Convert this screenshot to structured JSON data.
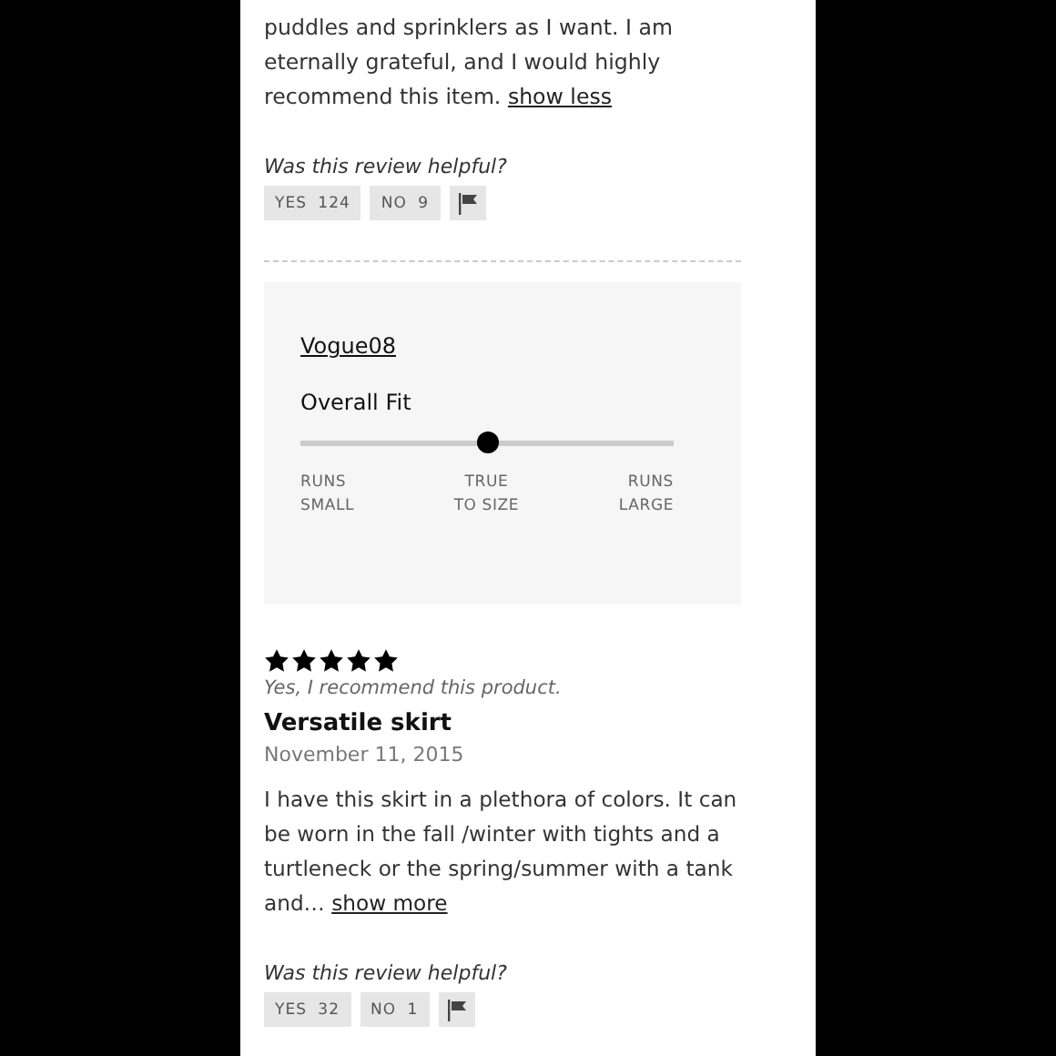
{
  "top_review": {
    "body_lines": [
      "puddles and sprinklers as I want. I am",
      "eternally grateful, and I would highly",
      "recommend this item."
    ],
    "toggle_link": "show less",
    "helpful": {
      "question": "Was this review helpful?",
      "yes_label": "YES",
      "yes_count": "124",
      "no_label": "NO",
      "no_count": "9"
    }
  },
  "reviewer_card": {
    "username": "Vogue08",
    "fit_title": "Overall Fit",
    "level": 0.5,
    "scale_labels": [
      [
        "RUNS",
        "SMALL"
      ],
      [
        "TRUE",
        "TO SIZE"
      ],
      [
        "RUNS",
        "LARGE"
      ]
    ]
  },
  "review": {
    "stars": 5,
    "recommend": "Yes, I recommend this product.",
    "title": "Versatile skirt",
    "date": "November 11, 2015",
    "body": "I have this skirt in a plethora of colors. It can be worn in the fall /winter with tights and a turtleneck or the spring/summer with a tank and…",
    "toggle_link": "show more",
    "helpful": {
      "question": "Was this review helpful?",
      "yes_label": "YES",
      "yes_count": "32",
      "no_label": "NO",
      "no_count": "1"
    }
  }
}
